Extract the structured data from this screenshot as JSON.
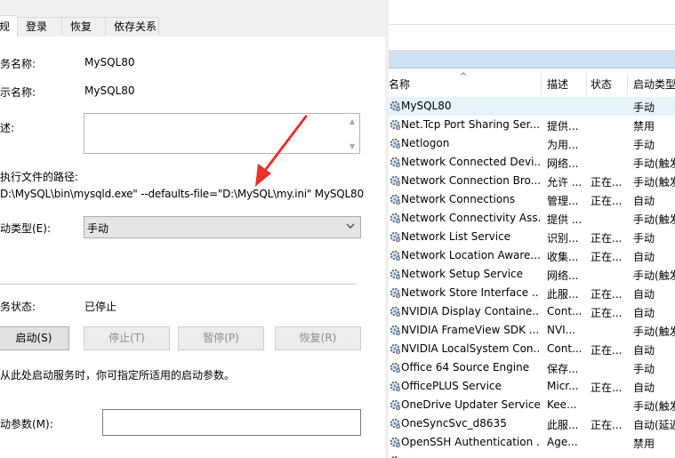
{
  "dialog": {
    "tabs": [
      "规",
      "登录",
      "恢复",
      "依存关系"
    ],
    "service_name_label": "务名称:",
    "service_name": "MySQL80",
    "display_name_label": "示名称:",
    "display_name": "MySQL80",
    "description_label": "述:",
    "exe_path_label": "执行文件的路径:",
    "exe_path": "D:\\MySQL\\bin\\mysqld.exe\" --defaults-file=\"D:\\MySQL\\my.ini\" MySQL80",
    "startup_type_label": "动类型(E):",
    "startup_type": "手动",
    "service_status_label": "务状态:",
    "service_status": "已停止",
    "buttons": {
      "start": "启动(S)",
      "stop": "停止(T)",
      "pause": "暂停(P)",
      "resume": "恢复(R)"
    },
    "hint": "从此处启动服务时，你可指定所适用的启动参数。",
    "start_params_label": "动参数(M):",
    "start_params_value": ""
  },
  "services": {
    "columns": [
      "名称",
      "描述",
      "状态",
      "启动类型"
    ],
    "rows": [
      {
        "name": "MySQL80",
        "desc": "",
        "status": "",
        "stype": "手动",
        "selected": true
      },
      {
        "name": "Net.Tcp Port Sharing Ser...",
        "desc": "提供...",
        "status": "",
        "stype": "禁用"
      },
      {
        "name": "Netlogon",
        "desc": "为用...",
        "status": "",
        "stype": "手动"
      },
      {
        "name": "Network Connected Devi...",
        "desc": "网络...",
        "status": "",
        "stype": "手动(触发"
      },
      {
        "name": "Network Connection Bro...",
        "desc": "允许 ...",
        "status": "正在...",
        "stype": "手动(触发"
      },
      {
        "name": "Network Connections",
        "desc": "管理...",
        "status": "正在...",
        "stype": "自动"
      },
      {
        "name": "Network Connectivity Ass...",
        "desc": "提供 ...",
        "status": "",
        "stype": "手动(触发"
      },
      {
        "name": "Network List Service",
        "desc": "识别...",
        "status": "正在...",
        "stype": "手动"
      },
      {
        "name": "Network Location Aware...",
        "desc": "收集...",
        "status": "正在...",
        "stype": "自动"
      },
      {
        "name": "Network Setup Service",
        "desc": "网络...",
        "status": "",
        "stype": "手动(触发"
      },
      {
        "name": "Network Store Interface ...",
        "desc": "此服...",
        "status": "正在...",
        "stype": "自动"
      },
      {
        "name": "NVIDIA Display Containe...",
        "desc": "Cont...",
        "status": "正在...",
        "stype": "自动"
      },
      {
        "name": "NVIDIA FrameView SDK ...",
        "desc": "NVI...",
        "status": "",
        "stype": "手动(触发"
      },
      {
        "name": "NVIDIA LocalSystem Con...",
        "desc": "Cont...",
        "status": "正在...",
        "stype": "自动"
      },
      {
        "name": "Office 64 Source Engine",
        "desc": "保存...",
        "status": "",
        "stype": "手动"
      },
      {
        "name": "OfficePLUS Service",
        "desc": "Micr...",
        "status": "正在...",
        "stype": "自动"
      },
      {
        "name": "OneDrive Updater Service",
        "desc": "Kee...",
        "status": "",
        "stype": "手动(触发"
      },
      {
        "name": "OneSyncSvc_d8635",
        "desc": "此服...",
        "status": "正在...",
        "stype": "自动(延迟"
      },
      {
        "name": "OpenSSH Authentication ...",
        "desc": "Age...",
        "status": "",
        "stype": "禁用"
      },
      {
        "name": "",
        "desc": "",
        "status": "",
        "stype": ""
      }
    ]
  },
  "colors": {
    "annotation_arrow": "#e8322b",
    "selected_row": "#e5f3fb",
    "header_bar": "#cfe1f3",
    "gear_icon": "#5a6f86"
  },
  "icons": {
    "service": "gear-icon",
    "dropdown": "chevron-down-icon",
    "annotation": "red-arrow-icon"
  }
}
